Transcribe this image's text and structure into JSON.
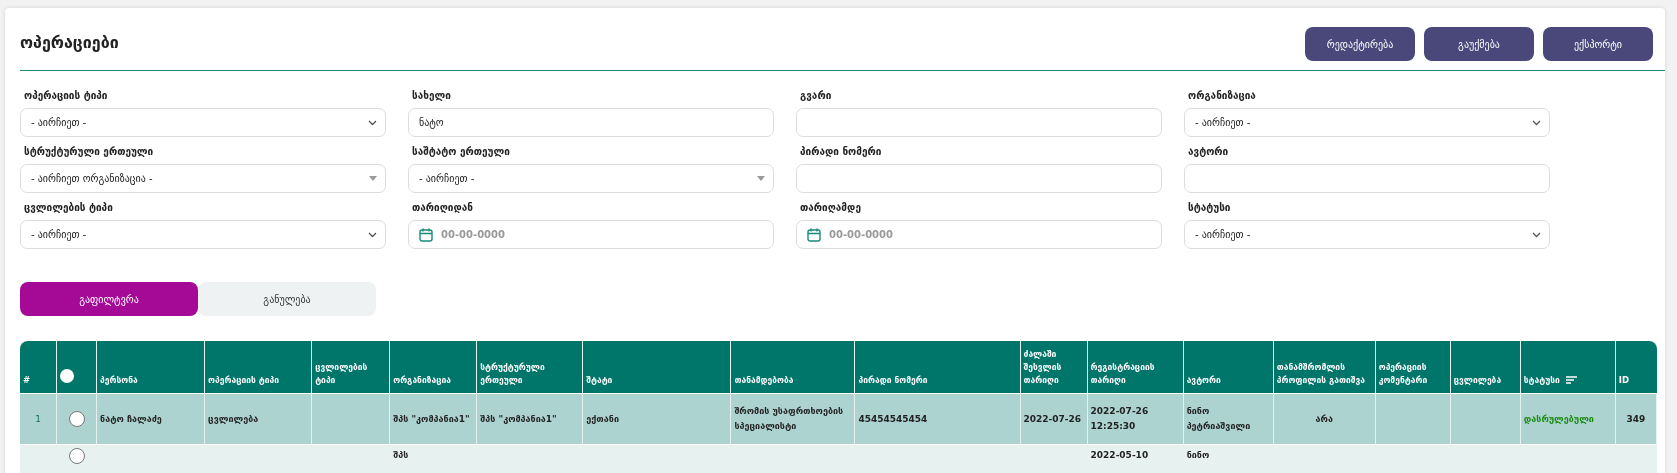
{
  "page": {
    "title": "ოპერაციები"
  },
  "header_buttons": [
    "რედაქტირება",
    "გაუქმება",
    "ექსპორტი"
  ],
  "filters": [
    {
      "label": "ოპერაციის ტიპი",
      "kind": "select",
      "value": "- აირჩიეთ -"
    },
    {
      "label": "სახელი",
      "kind": "text",
      "value": "ნატო"
    },
    {
      "label": "გვარი",
      "kind": "text"
    },
    {
      "label": "ორგანიზაცია",
      "kind": "select",
      "value": "- აირჩიეთ -"
    },
    {
      "label": "სტრუქტურული ერთეული",
      "kind": "combo",
      "value": "- აირჩიეთ ორგანიზაცია -"
    },
    {
      "label": "საშტატო ერთეული",
      "kind": "combo",
      "value": "- აირჩიეთ -"
    },
    {
      "label": "პირადი ნომერი",
      "kind": "text"
    },
    {
      "label": "ავტორი",
      "kind": "text"
    },
    {
      "label": "ცვლილების ტიპი",
      "kind": "select",
      "value": "- აირჩიეთ -"
    },
    {
      "label": "თარიღიდან",
      "kind": "date",
      "placeholder": "00-00-0000"
    },
    {
      "label": "თარიღამდე",
      "kind": "date",
      "placeholder": "00-00-0000"
    },
    {
      "label": "სტატუსი",
      "kind": "select",
      "value": "- აირჩიეთ -"
    }
  ],
  "actions": [
    {
      "label": "გაფილტვრა",
      "kind": "primary"
    },
    {
      "label": "განულება",
      "kind": "secondary"
    }
  ],
  "table": {
    "all_selected": false,
    "columns": [
      {
        "label": "#",
        "kind": "index",
        "sorted": false
      },
      {
        "kind": "check",
        "sorted": false
      },
      {
        "label": "პერსონა",
        "kind": "text",
        "sorted": false
      },
      {
        "label": "ოპერაციის ტიპი",
        "kind": "text",
        "sorted": false
      },
      {
        "label": "ცვლილების ტიპი",
        "kind": "text",
        "sorted": false
      },
      {
        "label": "ორგანიზაცია",
        "kind": "text",
        "sorted": false
      },
      {
        "label": "სტრუქტურული ერთეული",
        "kind": "text",
        "sorted": false
      },
      {
        "label": "შტატი",
        "kind": "text",
        "sorted": false
      },
      {
        "label": "თანამდებობა",
        "kind": "text",
        "sorted": false
      },
      {
        "label": "პირადი ნომერი",
        "kind": "text",
        "sorted": false
      },
      {
        "label": "ძალაში შესვლის თარიღი",
        "kind": "text",
        "sorted": false
      },
      {
        "label": "რეგისტრაციის თარიღი",
        "kind": "text",
        "sorted": false
      },
      {
        "label": "ავტორი",
        "kind": "text",
        "sorted": false
      },
      {
        "label": "თანამშრომლის პროფილის გათიშვა",
        "kind": "center",
        "sorted": false
      },
      {
        "label": "ოპერაციის კომენტარი",
        "kind": "text",
        "sorted": false
      },
      {
        "label": "ცვლილება",
        "kind": "text",
        "sorted": false
      },
      {
        "label": "სტატუსი",
        "kind": "status",
        "sorted": true
      },
      {
        "label": "ID",
        "kind": "center",
        "sorted": false
      }
    ],
    "rows": [
      {
        "selected": false,
        "cells": [
          "1",
          "",
          "ნატო ჩალაძე",
          "ცვლილება",
          "",
          "შპს \"კომპანია1\"",
          "შპს \"კომპანია1\"",
          "ექთანი",
          "შრომის უსაფრთხოების სპეციალისტი",
          "45454545454",
          "2022-07-26",
          "2022-07-26 12:25:30",
          "ნინო პეტრიაშვილი",
          "არა",
          "",
          "",
          "დასრულებული",
          "349"
        ]
      },
      {
        "selected": false,
        "cells": [
          "",
          "",
          "",
          "",
          "",
          "შპს",
          "",
          "",
          "",
          "",
          "",
          "2022-05-10",
          "ნინო",
          "",
          "",
          "",
          "",
          ""
        ]
      }
    ]
  }
}
